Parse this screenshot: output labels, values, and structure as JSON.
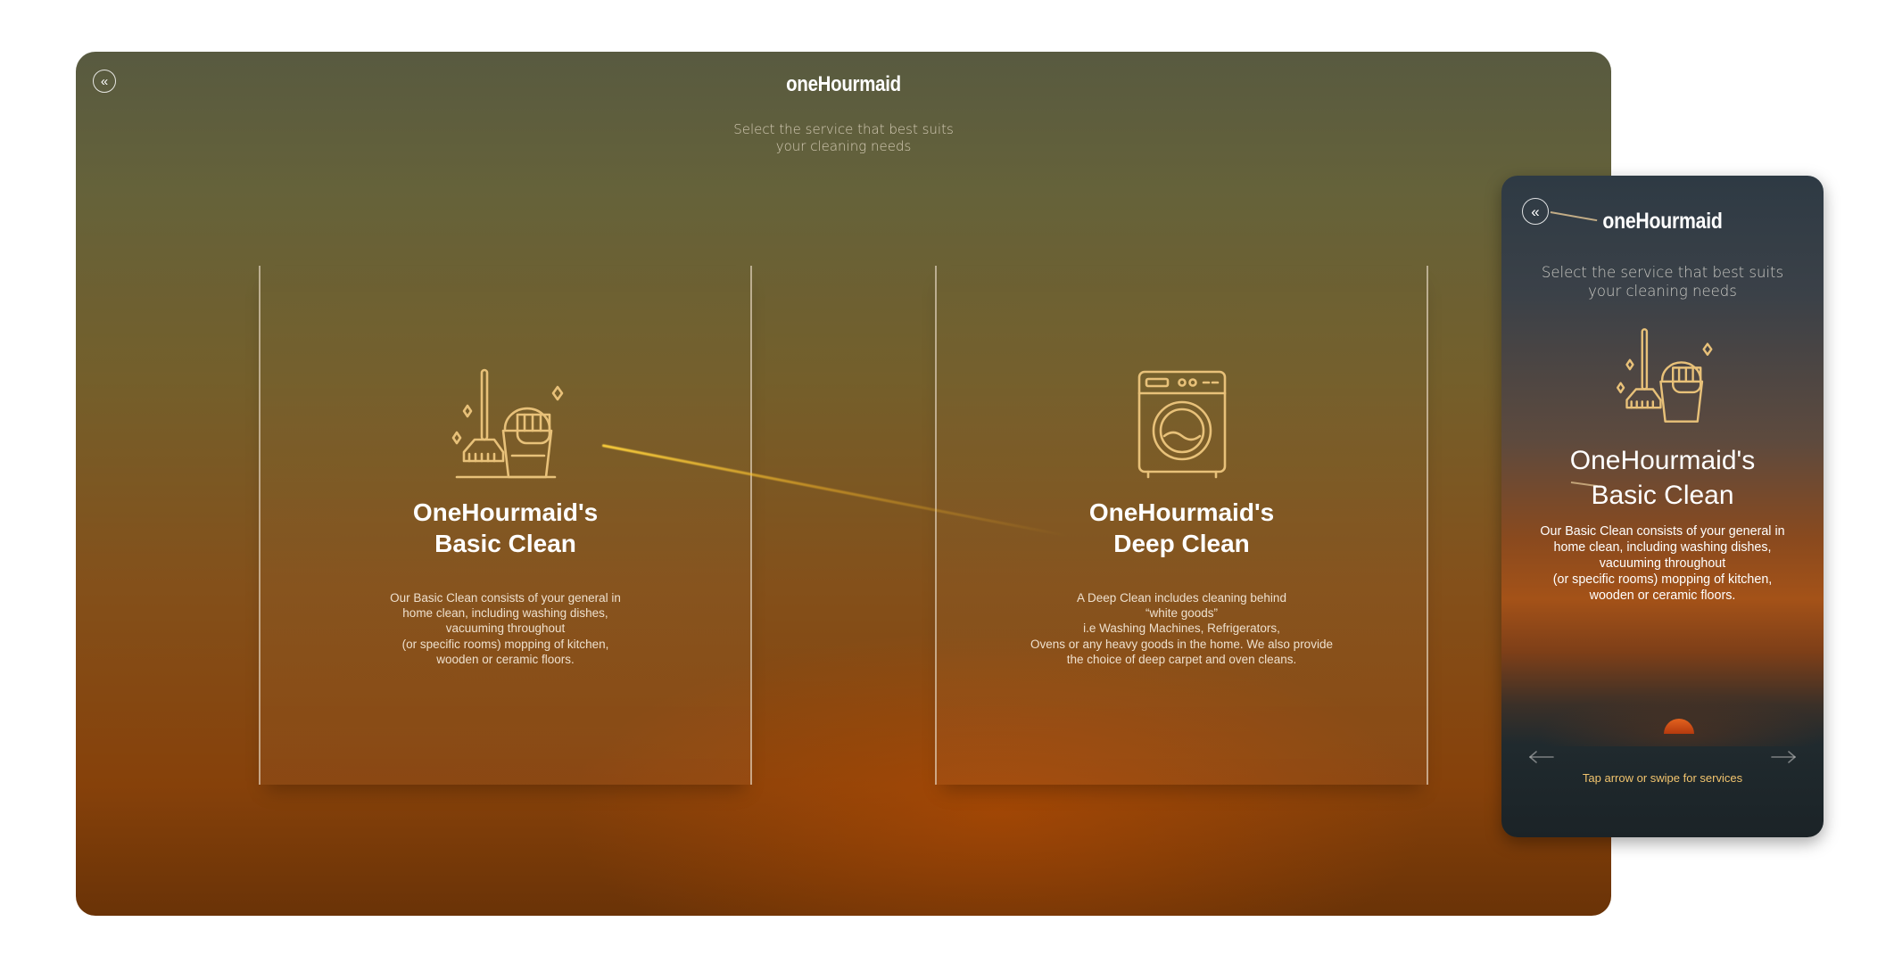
{
  "desktop": {
    "brand": "oneHourmaid",
    "subtitle_lines": [
      "Select the service that best suits",
      "your cleaning needs"
    ],
    "back_icon": "double-chevron-left-icon",
    "cards": [
      {
        "icon": "broom-bucket-icon",
        "title_lines": [
          "OneHourmaid's",
          "Basic Clean"
        ],
        "description_lines": [
          "Our Basic Clean consists of your general in",
          "home clean, including washing dishes,",
          "vacuuming throughout",
          "(or specific rooms) mopping of kitchen,",
          "wooden or ceramic floors."
        ]
      },
      {
        "icon": "washing-machine-icon",
        "title_lines": [
          "OneHourmaid's",
          "Deep Clean"
        ],
        "description_lines": [
          "A Deep Clean includes cleaning behind",
          "“white goods”",
          "i.e Washing Machines, Refrigerators,",
          "Ovens or any heavy goods in the home. We also provide",
          "the choice of deep carpet and oven cleans."
        ]
      }
    ]
  },
  "mobile": {
    "brand": "oneHourmaid",
    "subtitle_lines": [
      "Select the service that best suits",
      "your cleaning needs"
    ],
    "back_icon": "double-chevron-left-icon",
    "card": {
      "icon": "broom-bucket-icon",
      "title_lines": [
        "OneHourmaid's",
        "Basic Clean"
      ],
      "description_lines": [
        "Our Basic Clean consists of your general in",
        "home clean, including washing dishes,",
        "vacuuming throughout",
        "(or specific rooms) mopping of kitchen,",
        "wooden or ceramic floors."
      ]
    },
    "swipe_hint": "Tap arrow or swipe for services",
    "prev_icon": "arrow-left-icon",
    "next_icon": "arrow-right-icon"
  },
  "colors": {
    "accent_gold": "#f1c46e",
    "icon_gold": "#e8c179",
    "text_white": "#ffffff"
  }
}
